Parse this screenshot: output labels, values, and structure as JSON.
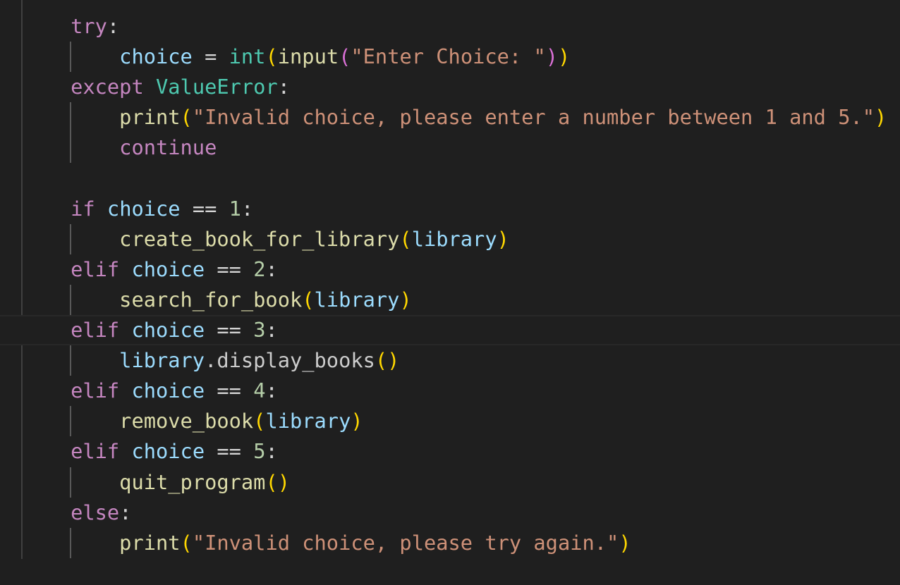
{
  "editor": {
    "language": "python",
    "current_line": 10,
    "colors": {
      "background": "#1f1f1f",
      "keyword": "#c586c0",
      "variable": "#9cdcfe",
      "function": "#dcdcaa",
      "class": "#4ec9b0",
      "string": "#ce9178",
      "number": "#b5cea8",
      "bracket1": "#ffd700",
      "bracket2": "#da70d6"
    },
    "lines": [
      {
        "tokens": [
          {
            "t": "    "
          },
          {
            "t": "try",
            "k": "kw"
          },
          {
            "t": ":",
            "k": "op"
          }
        ]
      },
      {
        "tokens": [
          {
            "t": "        "
          },
          {
            "t": "choice",
            "k": "var"
          },
          {
            "t": " = ",
            "k": "op"
          },
          {
            "t": "int",
            "k": "cls"
          },
          {
            "t": "(",
            "k": "b1"
          },
          {
            "t": "input",
            "k": "fn"
          },
          {
            "t": "(",
            "k": "b2"
          },
          {
            "t": "\"Enter Choice: \"",
            "k": "str"
          },
          {
            "t": ")",
            "k": "b2"
          },
          {
            "t": ")",
            "k": "b1"
          }
        ]
      },
      {
        "tokens": [
          {
            "t": "    "
          },
          {
            "t": "except",
            "k": "kw"
          },
          {
            "t": " "
          },
          {
            "t": "ValueError",
            "k": "cls"
          },
          {
            "t": ":",
            "k": "op"
          }
        ]
      },
      {
        "tokens": [
          {
            "t": "        "
          },
          {
            "t": "print",
            "k": "fn"
          },
          {
            "t": "(",
            "k": "b1"
          },
          {
            "t": "\"Invalid choice, please enter a number between 1 and 5.\"",
            "k": "str"
          },
          {
            "t": ")",
            "k": "b1"
          }
        ]
      },
      {
        "tokens": [
          {
            "t": "        "
          },
          {
            "t": "continue",
            "k": "kw"
          }
        ]
      },
      {
        "tokens": []
      },
      {
        "tokens": [
          {
            "t": "    "
          },
          {
            "t": "if",
            "k": "kw"
          },
          {
            "t": " "
          },
          {
            "t": "choice",
            "k": "var"
          },
          {
            "t": " == ",
            "k": "op"
          },
          {
            "t": "1",
            "k": "num"
          },
          {
            "t": ":",
            "k": "op"
          }
        ]
      },
      {
        "tokens": [
          {
            "t": "        "
          },
          {
            "t": "create_book_for_library",
            "k": "fn"
          },
          {
            "t": "(",
            "k": "b1"
          },
          {
            "t": "library",
            "k": "var"
          },
          {
            "t": ")",
            "k": "b1"
          }
        ]
      },
      {
        "tokens": [
          {
            "t": "    "
          },
          {
            "t": "elif",
            "k": "kw"
          },
          {
            "t": " "
          },
          {
            "t": "choice",
            "k": "var"
          },
          {
            "t": " == ",
            "k": "op"
          },
          {
            "t": "2",
            "k": "num"
          },
          {
            "t": ":",
            "k": "op"
          }
        ]
      },
      {
        "tokens": [
          {
            "t": "        "
          },
          {
            "t": "search_for_book",
            "k": "fn"
          },
          {
            "t": "(",
            "k": "b1"
          },
          {
            "t": "library",
            "k": "var"
          },
          {
            "t": ")",
            "k": "b1"
          }
        ]
      },
      {
        "tokens": [
          {
            "t": "    "
          },
          {
            "t": "elif",
            "k": "kw"
          },
          {
            "t": " "
          },
          {
            "t": "choice",
            "k": "var"
          },
          {
            "t": " == ",
            "k": "op"
          },
          {
            "t": "3",
            "k": "num"
          },
          {
            "t": ":",
            "k": "op"
          }
        ]
      },
      {
        "tokens": [
          {
            "t": "        "
          },
          {
            "t": "library",
            "k": "var"
          },
          {
            "t": ".display_books",
            "k": "pl"
          },
          {
            "t": "()",
            "k": "b1"
          }
        ]
      },
      {
        "tokens": [
          {
            "t": "    "
          },
          {
            "t": "elif",
            "k": "kw"
          },
          {
            "t": " "
          },
          {
            "t": "choice",
            "k": "var"
          },
          {
            "t": " == ",
            "k": "op"
          },
          {
            "t": "4",
            "k": "num"
          },
          {
            "t": ":",
            "k": "op"
          }
        ]
      },
      {
        "tokens": [
          {
            "t": "        "
          },
          {
            "t": "remove_book",
            "k": "fn"
          },
          {
            "t": "(",
            "k": "b1"
          },
          {
            "t": "library",
            "k": "var"
          },
          {
            "t": ")",
            "k": "b1"
          }
        ]
      },
      {
        "tokens": [
          {
            "t": "    "
          },
          {
            "t": "elif",
            "k": "kw"
          },
          {
            "t": " "
          },
          {
            "t": "choice",
            "k": "var"
          },
          {
            "t": " == ",
            "k": "op"
          },
          {
            "t": "5",
            "k": "num"
          },
          {
            "t": ":",
            "k": "op"
          }
        ]
      },
      {
        "tokens": [
          {
            "t": "        "
          },
          {
            "t": "quit_program",
            "k": "fn"
          },
          {
            "t": "()",
            "k": "b1"
          }
        ]
      },
      {
        "tokens": [
          {
            "t": "    "
          },
          {
            "t": "else",
            "k": "kw"
          },
          {
            "t": ":",
            "k": "op"
          }
        ]
      },
      {
        "tokens": [
          {
            "t": "        "
          },
          {
            "t": "print",
            "k": "fn"
          },
          {
            "t": "(",
            "k": "b1"
          },
          {
            "t": "\"Invalid choice, please try again.\"",
            "k": "str"
          },
          {
            "t": ")",
            "k": "b1"
          }
        ]
      }
    ]
  }
}
